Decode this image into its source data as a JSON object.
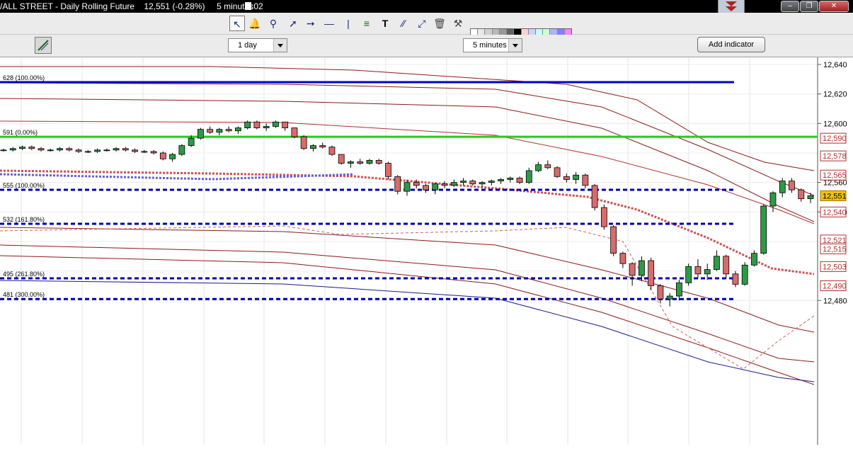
{
  "window": {
    "title": "/ALL STREET - Daily Rolling Future    12,551 (-0.28%)     5 minutes",
    "timer": ":02",
    "buttons": [
      "minimize",
      "restore",
      "close"
    ]
  },
  "toolbar": {
    "icons": [
      "pointer-icon",
      "alert-bell-icon",
      "zoom-icon",
      "trend-line-icon",
      "ray-line-icon",
      "horizontal-line-icon",
      "vertical-line-icon",
      "fibonacci-icon",
      "text-icon",
      "parallel-channel-icon",
      "fit-icon",
      "trash-icon",
      "tools-icon"
    ],
    "palette_colors": [
      "#ffffff",
      "#e8e8e8",
      "#d0d0d0",
      "#b8b8b8",
      "#989898",
      "#606060",
      "#000000",
      "#ffd0d0",
      "#d0d0ff",
      "#c0ffff",
      "#d0ffd0",
      "#b0b0ff",
      "#8080ff",
      "#ff80ff",
      "#ff0000",
      "#cc0000",
      "#ff4040",
      "#ff8080",
      "#ffa500",
      "#ffcc80",
      "#ffff00",
      "#c8e000",
      "#00ffff",
      "#00c0ff",
      "#00a000",
      "#00ff00",
      "#008000",
      "#40c040"
    ]
  },
  "controls": {
    "period_value": "1 day",
    "interval_value": "5 minutes",
    "add_indicator_label": "Add indicator"
  },
  "chart_data": {
    "type": "candlestick",
    "ylim": [
      12470,
      12642
    ],
    "y_ticks": [
      "12,640",
      "12,620",
      "12,600",
      "12,560",
      "12,540",
      "12,480"
    ],
    "price_badges": [
      {
        "label": "12,590",
        "value": 12590,
        "style": "red"
      },
      {
        "label": "12,578",
        "value": 12578,
        "style": "red"
      },
      {
        "label": "12,565",
        "value": 12565,
        "style": "red"
      },
      {
        "label": "12,551",
        "value": 12551,
        "style": "current"
      },
      {
        "label": "12,540",
        "value": 12540,
        "style": "red"
      },
      {
        "label": "12,521",
        "value": 12521,
        "style": "red"
      },
      {
        "label": "12,515",
        "value": 12515,
        "style": "red"
      },
      {
        "label": "12,503",
        "value": 12503,
        "style": "red"
      },
      {
        "label": "12,490",
        "value": 12490,
        "style": "red"
      }
    ],
    "fib_levels": [
      {
        "label": "628 (100.00%)",
        "value": 12628,
        "style": "solid",
        "color": "#0000cc"
      },
      {
        "label": "591 (0.00%)",
        "value": 12591,
        "style": "solid",
        "color": "#22cc22"
      },
      {
        "label": "555 (100.00%)",
        "value": 12555,
        "style": "dashed",
        "color": "#0000aa"
      },
      {
        "label": "532 (161.80%)",
        "value": 12532,
        "style": "dashed",
        "color": "#0000aa"
      },
      {
        "label": "495 (261.80%)",
        "value": 12495,
        "style": "dashed",
        "color": "#0000aa"
      },
      {
        "label": "481 (300.00%)",
        "value": 12481,
        "style": "dashed",
        "color": "#0000aa"
      }
    ],
    "candles": [
      [
        12582,
        12583,
        12581,
        12582
      ],
      [
        12582,
        12584,
        12581,
        12583
      ],
      [
        12583,
        12585,
        12582,
        12584
      ],
      [
        12584,
        12585,
        12582,
        12583
      ],
      [
        12583,
        12584,
        12581,
        12582
      ],
      [
        12582,
        12583,
        12581,
        12582
      ],
      [
        12582,
        12584,
        12581,
        12583
      ],
      [
        12583,
        12584,
        12581,
        12582
      ],
      [
        12582,
        12583,
        12580,
        12581
      ],
      [
        12581,
        12582,
        12580,
        12581
      ],
      [
        12581,
        12583,
        12580,
        12582
      ],
      [
        12582,
        12583,
        12581,
        12582
      ],
      [
        12582,
        12584,
        12581,
        12583
      ],
      [
        12583,
        12584,
        12581,
        12582
      ],
      [
        12582,
        12583,
        12580,
        12581
      ],
      [
        12581,
        12582,
        12580,
        12581
      ],
      [
        12581,
        12582,
        12579,
        12580
      ],
      [
        12580,
        12581,
        12575,
        12576
      ],
      [
        12576,
        12580,
        12574,
        12579
      ],
      [
        12579,
        12586,
        12578,
        12585
      ],
      [
        12585,
        12592,
        12584,
        12590
      ],
      [
        12590,
        12597,
        12589,
        12596
      ],
      [
        12596,
        12598,
        12593,
        12594
      ],
      [
        12594,
        12597,
        12592,
        12596
      ],
      [
        12596,
        12598,
        12594,
        12595
      ],
      [
        12595,
        12598,
        12593,
        12597
      ],
      [
        12597,
        12602,
        12596,
        12601
      ],
      [
        12601,
        12602,
        12596,
        12597
      ],
      [
        12597,
        12600,
        12595,
        12598
      ],
      [
        12598,
        12602,
        12597,
        12601
      ],
      [
        12601,
        12601,
        12595,
        12597
      ],
      [
        12597,
        12595,
        12590,
        12591
      ],
      [
        12591,
        12592,
        12582,
        12583
      ],
      [
        12583,
        12586,
        12581,
        12585
      ],
      [
        12585,
        12587,
        12583,
        12584
      ],
      [
        12584,
        12585,
        12578,
        12579
      ],
      [
        12579,
        12579,
        12572,
        12573
      ],
      [
        12573,
        12575,
        12570,
        12574
      ],
      [
        12574,
        12576,
        12572,
        12573
      ],
      [
        12573,
        12576,
        12572,
        12575
      ],
      [
        12575,
        12576,
        12572,
        12573
      ],
      [
        12573,
        12574,
        12562,
        12564
      ],
      [
        12564,
        12565,
        12552,
        12554
      ],
      [
        12554,
        12562,
        12551,
        12560
      ],
      [
        12560,
        12562,
        12556,
        12558
      ],
      [
        12558,
        12559,
        12553,
        12555
      ],
      [
        12555,
        12560,
        12552,
        12559
      ],
      [
        12559,
        12561,
        12556,
        12558
      ],
      [
        12558,
        12562,
        12557,
        12560
      ],
      [
        12560,
        12563,
        12558,
        12561
      ],
      [
        12561,
        12562,
        12558,
        12559
      ],
      [
        12559,
        12561,
        12557,
        12560
      ],
      [
        12560,
        12562,
        12558,
        12561
      ],
      [
        12561,
        12563,
        12559,
        12562
      ],
      [
        12562,
        12564,
        12560,
        12563
      ],
      [
        12563,
        12564,
        12559,
        12560
      ],
      [
        12560,
        12570,
        12559,
        12568
      ],
      [
        12568,
        12574,
        12567,
        12572
      ],
      [
        12572,
        12575,
        12569,
        12570
      ],
      [
        12570,
        12571,
        12563,
        12564
      ],
      [
        12564,
        12566,
        12560,
        12562
      ],
      [
        12562,
        12567,
        12559,
        12565
      ],
      [
        12565,
        12566,
        12556,
        12558
      ],
      [
        12558,
        12559,
        12541,
        12543
      ],
      [
        12543,
        12545,
        12528,
        12530
      ],
      [
        12530,
        12531,
        12510,
        12512
      ],
      [
        12512,
        12513,
        12502,
        12505
      ],
      [
        12505,
        12506,
        12490,
        12497
      ],
      [
        12497,
        12510,
        12493,
        12507
      ],
      [
        12507,
        12509,
        12487,
        12490
      ],
      [
        12490,
        12491,
        12478,
        12481
      ],
      [
        12481,
        12485,
        12476,
        12483
      ],
      [
        12483,
        12494,
        12480,
        12492
      ],
      [
        12492,
        12505,
        12490,
        12503
      ],
      [
        12503,
        12508,
        12495,
        12498
      ],
      [
        12498,
        12505,
        12494,
        12501
      ],
      [
        12501,
        12514,
        12500,
        12510
      ],
      [
        12510,
        12511,
        12495,
        12498
      ],
      [
        12498,
        12500,
        12489,
        12491
      ],
      [
        12491,
        12506,
        12490,
        12504
      ],
      [
        12504,
        12514,
        12503,
        12512
      ],
      [
        12512,
        12545,
        12511,
        12544
      ],
      [
        12544,
        12554,
        12540,
        12553
      ],
      [
        12553,
        12563,
        12550,
        12561
      ],
      [
        12561,
        12563,
        12553,
        12555
      ],
      [
        12555,
        12556,
        12547,
        12549
      ],
      [
        12549,
        12553,
        12546,
        12551
      ]
    ]
  }
}
